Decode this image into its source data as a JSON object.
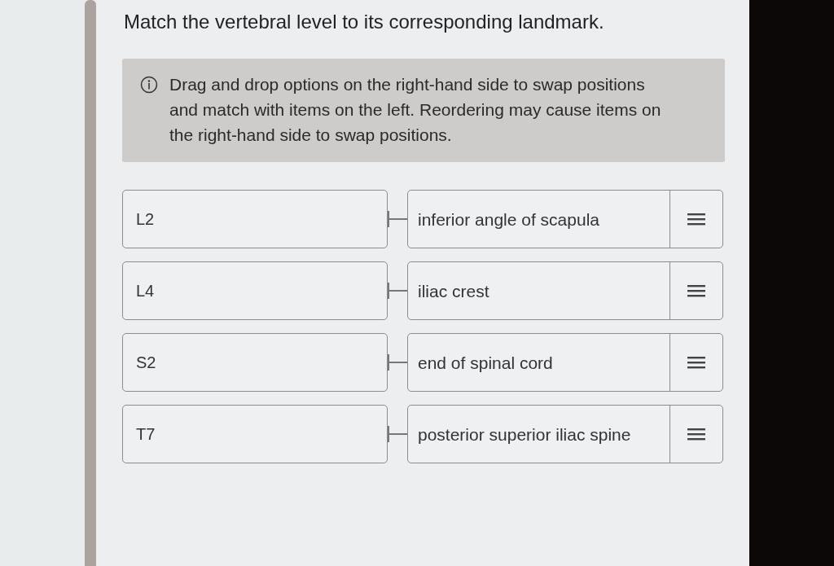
{
  "question": "Match the vertebral level to its corresponding landmark.",
  "instructions": "Drag and drop options on the right-hand side to swap positions and match with items on the left. Reordering may cause items on the right-hand side to swap positions.",
  "pairs": [
    {
      "level": "L2",
      "landmark": "inferior angle of scapula"
    },
    {
      "level": "L4",
      "landmark": "iliac crest"
    },
    {
      "level": "S2",
      "landmark": "end of spinal cord"
    },
    {
      "level": "T7",
      "landmark": "posterior superior iliac spine"
    }
  ]
}
